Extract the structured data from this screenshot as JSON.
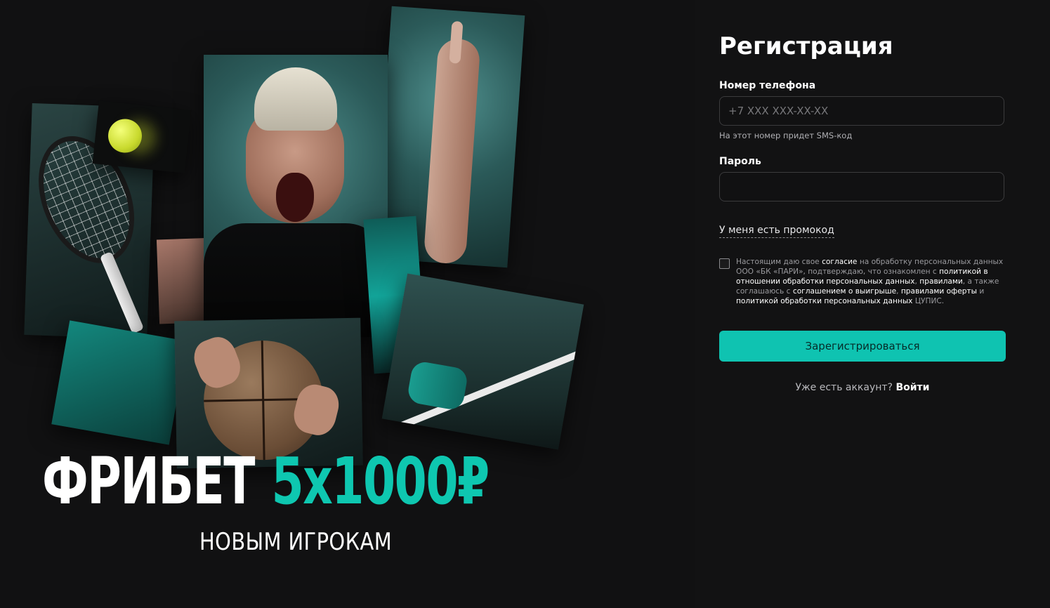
{
  "promo": {
    "headline_white": "ФРИБЕТ",
    "headline_teal": "5x1000₽",
    "subline": "НОВЫМ ИГРОКАМ"
  },
  "form": {
    "title": "Регистрация",
    "phone_label": "Номер телефона",
    "phone_placeholder": "+7 XXX XXX-XX-XX",
    "phone_hint": "На этот номер придет SMS-код",
    "password_label": "Пароль",
    "password_placeholder": "",
    "promo_link": "У меня есть промокод",
    "consent": {
      "t1": "Настоящим даю свое ",
      "l1": "согласие",
      "t2": " на обработку персональных данных ООО «БК «ПАРИ», подтверждаю, что ознакомлен с ",
      "l2": "политикой в отношении обработки персональных данных",
      "t3": ", ",
      "l3": "правилами",
      "t4": ", а также соглашаюсь с ",
      "l4": "соглашением о выигрыше",
      "t5": ", ",
      "l5": "правилами оферты",
      "t6": " и ",
      "l6": "политикой обработки персональных данных",
      "t7": " ЦУПИС."
    },
    "submit_label": "Зарегистрироваться",
    "login_prompt": "Уже есть аккаунт?",
    "login_link": "Войти"
  },
  "colors": {
    "accent": "#0fc3b1",
    "background": "#111112"
  }
}
